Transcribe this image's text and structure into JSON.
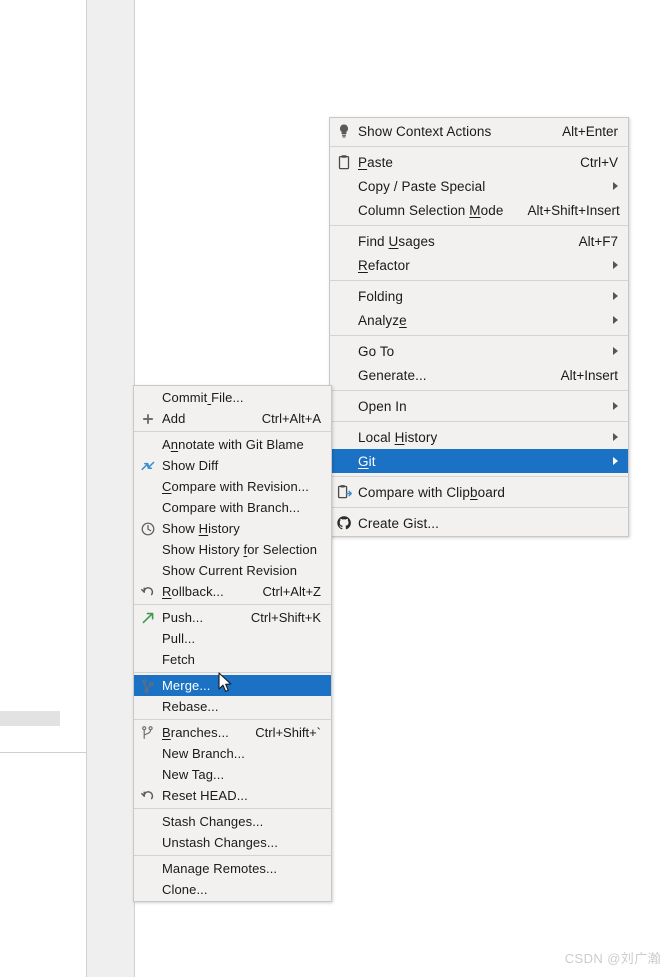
{
  "watermark": {
    "text": "CSDN @刘广瀚"
  },
  "context_menu": {
    "items": [
      {
        "label": "Show Context Actions",
        "accel": "Alt+Enter",
        "icon": "lightbulb-icon",
        "arrow": false,
        "selected": false,
        "mnemonic": -1
      },
      {
        "separator": true
      },
      {
        "label": "Paste",
        "accel": "Ctrl+V",
        "icon": "clipboard-paste-icon",
        "arrow": false,
        "selected": false,
        "mnemonic": 0
      },
      {
        "label": "Copy / Paste Special",
        "accel": "",
        "icon": "",
        "arrow": true,
        "selected": false,
        "mnemonic": -1
      },
      {
        "label": "Column Selection Mode",
        "accel": "Alt+Shift+Insert",
        "icon": "",
        "arrow": false,
        "selected": false,
        "mnemonic": 17
      },
      {
        "separator": true
      },
      {
        "label": "Find Usages",
        "accel": "Alt+F7",
        "icon": "",
        "arrow": false,
        "selected": false,
        "mnemonic": 5
      },
      {
        "label": "Refactor",
        "accel": "",
        "icon": "",
        "arrow": true,
        "selected": false,
        "mnemonic": 0
      },
      {
        "separator": true
      },
      {
        "label": "Folding",
        "accel": "",
        "icon": "",
        "arrow": true,
        "selected": false,
        "mnemonic": -1
      },
      {
        "label": "Analyze",
        "accel": "",
        "icon": "",
        "arrow": true,
        "selected": false,
        "mnemonic": 6
      },
      {
        "separator": true
      },
      {
        "label": "Go To",
        "accel": "",
        "icon": "",
        "arrow": true,
        "selected": false,
        "mnemonic": -1
      },
      {
        "label": "Generate...",
        "accel": "Alt+Insert",
        "icon": "",
        "arrow": false,
        "selected": false,
        "mnemonic": -1
      },
      {
        "separator": true
      },
      {
        "label": "Open In",
        "accel": "",
        "icon": "",
        "arrow": true,
        "selected": false,
        "mnemonic": -1
      },
      {
        "separator": true
      },
      {
        "label": "Local History",
        "accel": "",
        "icon": "",
        "arrow": true,
        "selected": false,
        "mnemonic": 6
      },
      {
        "label": "Git",
        "accel": "",
        "icon": "",
        "arrow": true,
        "selected": true,
        "mnemonic": 0
      },
      {
        "separator": true
      },
      {
        "label": "Compare with Clipboard",
        "accel": "",
        "icon": "compare-clipboard-icon",
        "arrow": false,
        "selected": false,
        "mnemonic": 17
      },
      {
        "separator": true
      },
      {
        "label": "Create Gist...",
        "accel": "",
        "icon": "github-icon",
        "arrow": false,
        "selected": false,
        "mnemonic": -1
      }
    ]
  },
  "git_submenu": {
    "items": [
      {
        "label": "Commit File...",
        "accel": "",
        "icon": "",
        "arrow": false,
        "selected": false,
        "mnemonic": 6
      },
      {
        "label": "Add",
        "accel": "Ctrl+Alt+A",
        "icon": "plus-icon",
        "arrow": false,
        "selected": false,
        "mnemonic": -1
      },
      {
        "separator": true
      },
      {
        "label": "Annotate with Git Blame",
        "accel": "",
        "icon": "",
        "arrow": false,
        "selected": false,
        "mnemonic": 1
      },
      {
        "label": "Show Diff",
        "accel": "",
        "icon": "diff-arrows-icon",
        "arrow": false,
        "selected": false,
        "mnemonic": -1
      },
      {
        "label": "Compare with Revision...",
        "accel": "",
        "icon": "",
        "arrow": false,
        "selected": false,
        "mnemonic": 0
      },
      {
        "label": "Compare with Branch...",
        "accel": "",
        "icon": "",
        "arrow": false,
        "selected": false,
        "mnemonic": -1
      },
      {
        "label": "Show History",
        "accel": "",
        "icon": "clock-icon",
        "arrow": false,
        "selected": false,
        "mnemonic": 5
      },
      {
        "label": "Show History for Selection",
        "accel": "",
        "icon": "",
        "arrow": false,
        "selected": false,
        "mnemonic": 13
      },
      {
        "label": "Show Current Revision",
        "accel": "",
        "icon": "",
        "arrow": false,
        "selected": false,
        "mnemonic": -1
      },
      {
        "label": "Rollback...",
        "accel": "Ctrl+Alt+Z",
        "icon": "undo-icon",
        "arrow": false,
        "selected": false,
        "mnemonic": 0
      },
      {
        "separator": true
      },
      {
        "label": "Push...",
        "accel": "Ctrl+Shift+K",
        "icon": "push-arrow-icon",
        "arrow": false,
        "selected": false,
        "mnemonic": -1
      },
      {
        "label": "Pull...",
        "accel": "",
        "icon": "",
        "arrow": false,
        "selected": false,
        "mnemonic": -1
      },
      {
        "label": "Fetch",
        "accel": "",
        "icon": "",
        "arrow": false,
        "selected": false,
        "mnemonic": -1
      },
      {
        "separator": true
      },
      {
        "label": "Merge...",
        "accel": "",
        "icon": "merge-icon",
        "arrow": false,
        "selected": true,
        "mnemonic": -1
      },
      {
        "label": "Rebase...",
        "accel": "",
        "icon": "",
        "arrow": false,
        "selected": false,
        "mnemonic": -1
      },
      {
        "separator": true
      },
      {
        "label": "Branches...",
        "accel": "Ctrl+Shift+`",
        "icon": "branch-icon",
        "arrow": false,
        "selected": false,
        "mnemonic": 0
      },
      {
        "label": "New Branch...",
        "accel": "",
        "icon": "",
        "arrow": false,
        "selected": false,
        "mnemonic": -1
      },
      {
        "label": "New Tag...",
        "accel": "",
        "icon": "",
        "arrow": false,
        "selected": false,
        "mnemonic": -1
      },
      {
        "label": "Reset HEAD...",
        "accel": "",
        "icon": "undo-icon",
        "arrow": false,
        "selected": false,
        "mnemonic": -1
      },
      {
        "separator": true
      },
      {
        "label": "Stash Changes...",
        "accel": "",
        "icon": "",
        "arrow": false,
        "selected": false,
        "mnemonic": -1
      },
      {
        "label": "Unstash Changes...",
        "accel": "",
        "icon": "",
        "arrow": false,
        "selected": false,
        "mnemonic": -1
      },
      {
        "separator": true
      },
      {
        "label": "Manage Remotes...",
        "accel": "",
        "icon": "",
        "arrow": false,
        "selected": false,
        "mnemonic": -1
      },
      {
        "label": "Clone...",
        "accel": "",
        "icon": "",
        "arrow": false,
        "selected": false,
        "mnemonic": -1
      }
    ]
  },
  "colors": {
    "menu_background": "#f2f1f0",
    "menu_border": "#c8c8c8",
    "selection_blue": "#1b72c4",
    "separator": "#d4d3d1",
    "text": "#1a1a1a",
    "gutter": "#efefef",
    "watermark": "#cccccc"
  }
}
